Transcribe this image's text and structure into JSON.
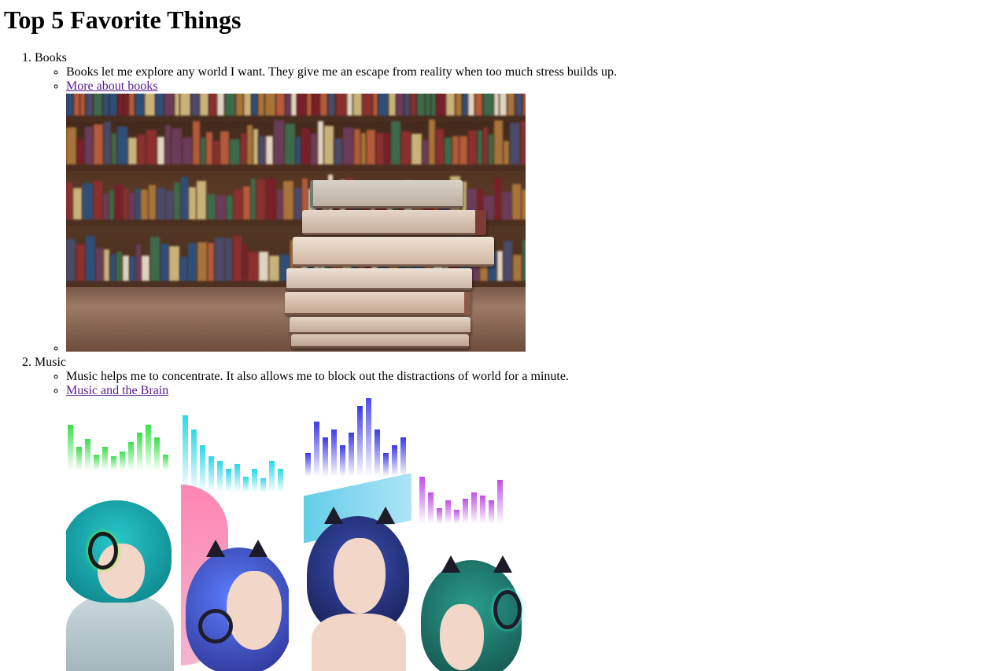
{
  "page": {
    "title": "Top 5 Favorite Things"
  },
  "items": [
    {
      "label": "Books",
      "description": "Books let me explore any world I want. They give me an escape from reality when too much stress builds up.",
      "link_text": "More about books"
    },
    {
      "label": "Music",
      "description": "Music helps me to concentrate. It also allows me to block out the distractions of world for a minute.",
      "link_text": "Music and the Brain"
    }
  ],
  "colors": {
    "link_visited": "#551a8b",
    "text": "#000000",
    "background": "#ffffff"
  }
}
